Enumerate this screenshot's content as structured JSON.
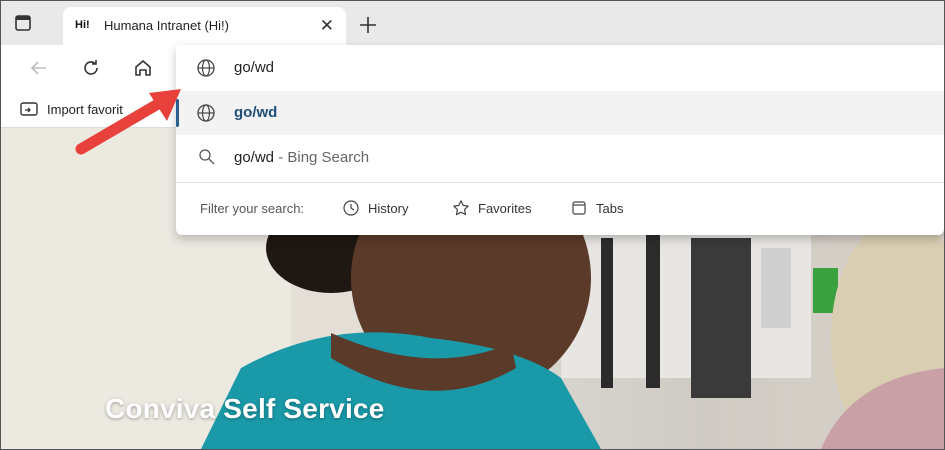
{
  "tab": {
    "favicon_text": "Hi!",
    "title": "Humana Intranet (Hi!)"
  },
  "favorites_bar": {
    "import_label": "Import favorit"
  },
  "omnibox": {
    "input_value": "go/wd",
    "suggestions": [
      {
        "text": "go/wd",
        "icon": "globe-icon"
      },
      {
        "text": "go/wd",
        "suffix": " - Bing Search",
        "icon": "search-icon"
      }
    ],
    "filter_label": "Filter your search:",
    "filters": [
      {
        "label": "History",
        "icon": "history-icon"
      },
      {
        "label": "Favorites",
        "icon": "star-icon"
      },
      {
        "label": "Tabs",
        "icon": "tabs-icon"
      }
    ]
  },
  "page": {
    "banner_title": "Conviva Self Service"
  },
  "colors": {
    "accent": "#2b5d8e",
    "arrow": "#e8403a"
  }
}
